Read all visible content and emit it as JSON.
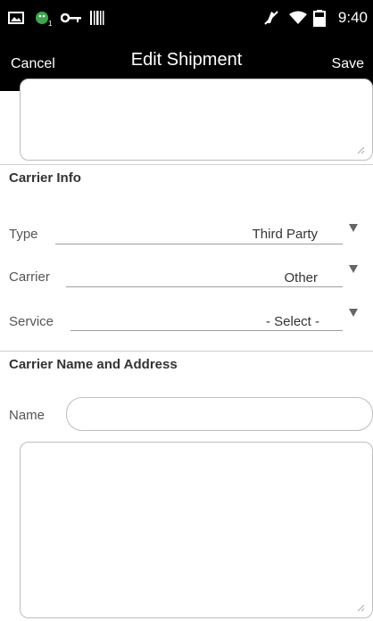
{
  "status_bar": {
    "time": "9:40",
    "icons": [
      "image-icon",
      "android-notification-icon",
      "key-icon",
      "barcode-icon",
      "mute-icon",
      "wifi-icon",
      "battery-icon"
    ]
  },
  "navbar": {
    "cancel_label": "Cancel",
    "title": "Edit Shipment",
    "save_label": "Save"
  },
  "carrier_info": {
    "title": "Carrier Info",
    "fields": [
      {
        "label": "Type",
        "value": "Third Party"
      },
      {
        "label": "Carrier",
        "value": "Other"
      },
      {
        "label": "Service",
        "value": "- Select -"
      }
    ]
  },
  "carrier_name_address": {
    "title": "Carrier Name and Address",
    "name_label": "Name",
    "name_value": ""
  },
  "colors": {
    "bar_background": "#000000",
    "page_background": "#ffffff",
    "border": "#bdbdbd"
  }
}
